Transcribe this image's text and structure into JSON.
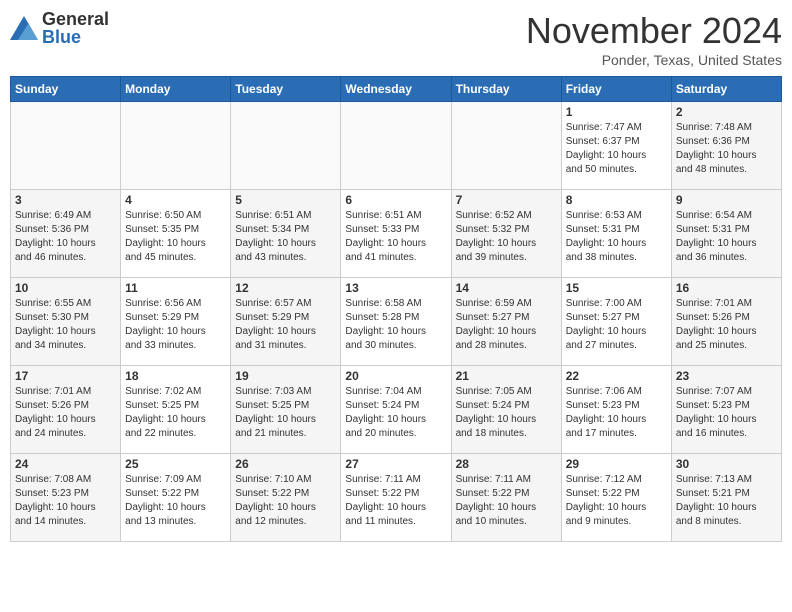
{
  "header": {
    "logo_general": "General",
    "logo_blue": "Blue",
    "month_title": "November 2024",
    "location": "Ponder, Texas, United States"
  },
  "days_of_week": [
    "Sunday",
    "Monday",
    "Tuesday",
    "Wednesday",
    "Thursday",
    "Friday",
    "Saturday"
  ],
  "weeks": [
    {
      "days": [
        {
          "num": "",
          "info": ""
        },
        {
          "num": "",
          "info": ""
        },
        {
          "num": "",
          "info": ""
        },
        {
          "num": "",
          "info": ""
        },
        {
          "num": "",
          "info": ""
        },
        {
          "num": "1",
          "info": "Sunrise: 7:47 AM\nSunset: 6:37 PM\nDaylight: 10 hours\nand 50 minutes."
        },
        {
          "num": "2",
          "info": "Sunrise: 7:48 AM\nSunset: 6:36 PM\nDaylight: 10 hours\nand 48 minutes."
        }
      ]
    },
    {
      "days": [
        {
          "num": "3",
          "info": "Sunrise: 6:49 AM\nSunset: 5:36 PM\nDaylight: 10 hours\nand 46 minutes."
        },
        {
          "num": "4",
          "info": "Sunrise: 6:50 AM\nSunset: 5:35 PM\nDaylight: 10 hours\nand 45 minutes."
        },
        {
          "num": "5",
          "info": "Sunrise: 6:51 AM\nSunset: 5:34 PM\nDaylight: 10 hours\nand 43 minutes."
        },
        {
          "num": "6",
          "info": "Sunrise: 6:51 AM\nSunset: 5:33 PM\nDaylight: 10 hours\nand 41 minutes."
        },
        {
          "num": "7",
          "info": "Sunrise: 6:52 AM\nSunset: 5:32 PM\nDaylight: 10 hours\nand 39 minutes."
        },
        {
          "num": "8",
          "info": "Sunrise: 6:53 AM\nSunset: 5:31 PM\nDaylight: 10 hours\nand 38 minutes."
        },
        {
          "num": "9",
          "info": "Sunrise: 6:54 AM\nSunset: 5:31 PM\nDaylight: 10 hours\nand 36 minutes."
        }
      ]
    },
    {
      "days": [
        {
          "num": "10",
          "info": "Sunrise: 6:55 AM\nSunset: 5:30 PM\nDaylight: 10 hours\nand 34 minutes."
        },
        {
          "num": "11",
          "info": "Sunrise: 6:56 AM\nSunset: 5:29 PM\nDaylight: 10 hours\nand 33 minutes."
        },
        {
          "num": "12",
          "info": "Sunrise: 6:57 AM\nSunset: 5:29 PM\nDaylight: 10 hours\nand 31 minutes."
        },
        {
          "num": "13",
          "info": "Sunrise: 6:58 AM\nSunset: 5:28 PM\nDaylight: 10 hours\nand 30 minutes."
        },
        {
          "num": "14",
          "info": "Sunrise: 6:59 AM\nSunset: 5:27 PM\nDaylight: 10 hours\nand 28 minutes."
        },
        {
          "num": "15",
          "info": "Sunrise: 7:00 AM\nSunset: 5:27 PM\nDaylight: 10 hours\nand 27 minutes."
        },
        {
          "num": "16",
          "info": "Sunrise: 7:01 AM\nSunset: 5:26 PM\nDaylight: 10 hours\nand 25 minutes."
        }
      ]
    },
    {
      "days": [
        {
          "num": "17",
          "info": "Sunrise: 7:01 AM\nSunset: 5:26 PM\nDaylight: 10 hours\nand 24 minutes."
        },
        {
          "num": "18",
          "info": "Sunrise: 7:02 AM\nSunset: 5:25 PM\nDaylight: 10 hours\nand 22 minutes."
        },
        {
          "num": "19",
          "info": "Sunrise: 7:03 AM\nSunset: 5:25 PM\nDaylight: 10 hours\nand 21 minutes."
        },
        {
          "num": "20",
          "info": "Sunrise: 7:04 AM\nSunset: 5:24 PM\nDaylight: 10 hours\nand 20 minutes."
        },
        {
          "num": "21",
          "info": "Sunrise: 7:05 AM\nSunset: 5:24 PM\nDaylight: 10 hours\nand 18 minutes."
        },
        {
          "num": "22",
          "info": "Sunrise: 7:06 AM\nSunset: 5:23 PM\nDaylight: 10 hours\nand 17 minutes."
        },
        {
          "num": "23",
          "info": "Sunrise: 7:07 AM\nSunset: 5:23 PM\nDaylight: 10 hours\nand 16 minutes."
        }
      ]
    },
    {
      "days": [
        {
          "num": "24",
          "info": "Sunrise: 7:08 AM\nSunset: 5:23 PM\nDaylight: 10 hours\nand 14 minutes."
        },
        {
          "num": "25",
          "info": "Sunrise: 7:09 AM\nSunset: 5:22 PM\nDaylight: 10 hours\nand 13 minutes."
        },
        {
          "num": "26",
          "info": "Sunrise: 7:10 AM\nSunset: 5:22 PM\nDaylight: 10 hours\nand 12 minutes."
        },
        {
          "num": "27",
          "info": "Sunrise: 7:11 AM\nSunset: 5:22 PM\nDaylight: 10 hours\nand 11 minutes."
        },
        {
          "num": "28",
          "info": "Sunrise: 7:11 AM\nSunset: 5:22 PM\nDaylight: 10 hours\nand 10 minutes."
        },
        {
          "num": "29",
          "info": "Sunrise: 7:12 AM\nSunset: 5:22 PM\nDaylight: 10 hours\nand 9 minutes."
        },
        {
          "num": "30",
          "info": "Sunrise: 7:13 AM\nSunset: 5:21 PM\nDaylight: 10 hours\nand 8 minutes."
        }
      ]
    }
  ]
}
